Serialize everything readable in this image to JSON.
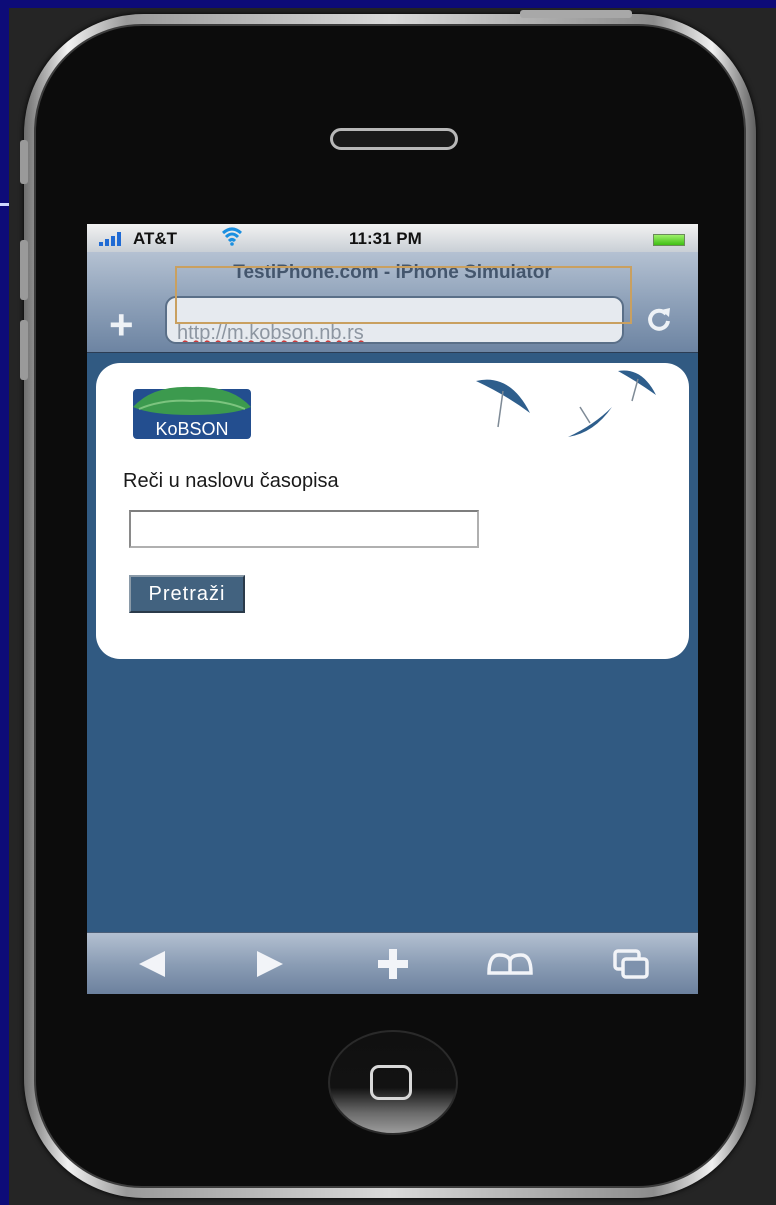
{
  "status_bar": {
    "carrier": "AT&T",
    "time": "11:31 PM",
    "signal_icon": "signal-bars-icon",
    "wifi_icon": "wifi-icon",
    "battery_icon": "battery-icon",
    "battery_level": 1.0
  },
  "browser": {
    "page_title": "TestiPhone.com - iPhone Simulator",
    "url": "http://m.kobson.nb.rs",
    "add_icon": "plus-icon",
    "reload_icon": "reload-icon"
  },
  "page": {
    "logo_text": "KoBSON",
    "search_label": "Reči u naslovu časopisa",
    "search_value": "",
    "search_button": "Pretraži"
  },
  "toolbar": {
    "items": [
      "back-arrow-icon",
      "forward-arrow-icon",
      "plus-icon",
      "bookmarks-icon",
      "pages-icon"
    ]
  },
  "colors": {
    "page_background": "#315a82",
    "slide_background": "#0d0b78",
    "button": "#42627f"
  }
}
